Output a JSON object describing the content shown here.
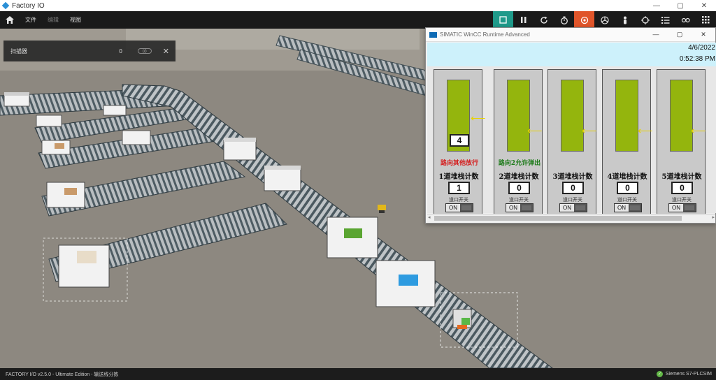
{
  "app": {
    "title": "Factory IO"
  },
  "window_controls": {
    "minimize": "—",
    "maximize": "▢",
    "close": "✕"
  },
  "menu": {
    "file": "文件",
    "edit": "编辑",
    "view": "视图"
  },
  "toolbar": {
    "icons": [
      "camera-square-icon",
      "pause-icon",
      "reset-icon",
      "timer-icon",
      "drivers-icon",
      "fan-icon",
      "person-icon",
      "target-icon",
      "list-icon",
      "sensors-icon",
      "grid-icon"
    ]
  },
  "sensor_panel": {
    "label": "扫描器",
    "value": "0",
    "conn": "⟨/⟩",
    "close": "✕"
  },
  "wincc": {
    "title": "SIMATIC WinCC Runtime Advanced",
    "date": "4/6/2022",
    "time": "0:52:38 PM",
    "lanes": [
      {
        "count_box": "4",
        "route_text": "路向其他放行",
        "route_color": "#d42020",
        "stack_label": "1道堆栈计数",
        "stack_value": "1",
        "switch_label": "道口开关",
        "switch": "ON"
      },
      {
        "count_box": "",
        "route_text": "路向2允许弹出",
        "route_color": "#1c7a18",
        "stack_label": "2道堆栈计数",
        "stack_value": "0",
        "switch_label": "道口开关",
        "switch": "ON"
      },
      {
        "count_box": "",
        "route_text": "",
        "route_color": "#000000",
        "stack_label": "3道堆栈计数",
        "stack_value": "0",
        "switch_label": "道口开关",
        "switch": "ON"
      },
      {
        "count_box": "",
        "route_text": "",
        "route_color": "#000000",
        "stack_label": "4道堆栈计数",
        "stack_value": "0",
        "switch_label": "道口开关",
        "switch": "ON"
      },
      {
        "count_box": "",
        "route_text": "",
        "route_color": "#000000",
        "stack_label": "5道堆栈计数",
        "stack_value": "0",
        "switch_label": "道口开关",
        "switch": "ON"
      }
    ]
  },
  "statusbar": {
    "left": "FACTORY I/O v2.5.0 - Ultimate Edition - 输送线分拣",
    "plc": "Siemens S7-PLCSIM"
  },
  "colors": {
    "accent_teal": "#1f9a8a",
    "accent_orange": "#e0552a",
    "lane_bar": "#94b50d",
    "hmi_header": "#cdf1fb"
  }
}
